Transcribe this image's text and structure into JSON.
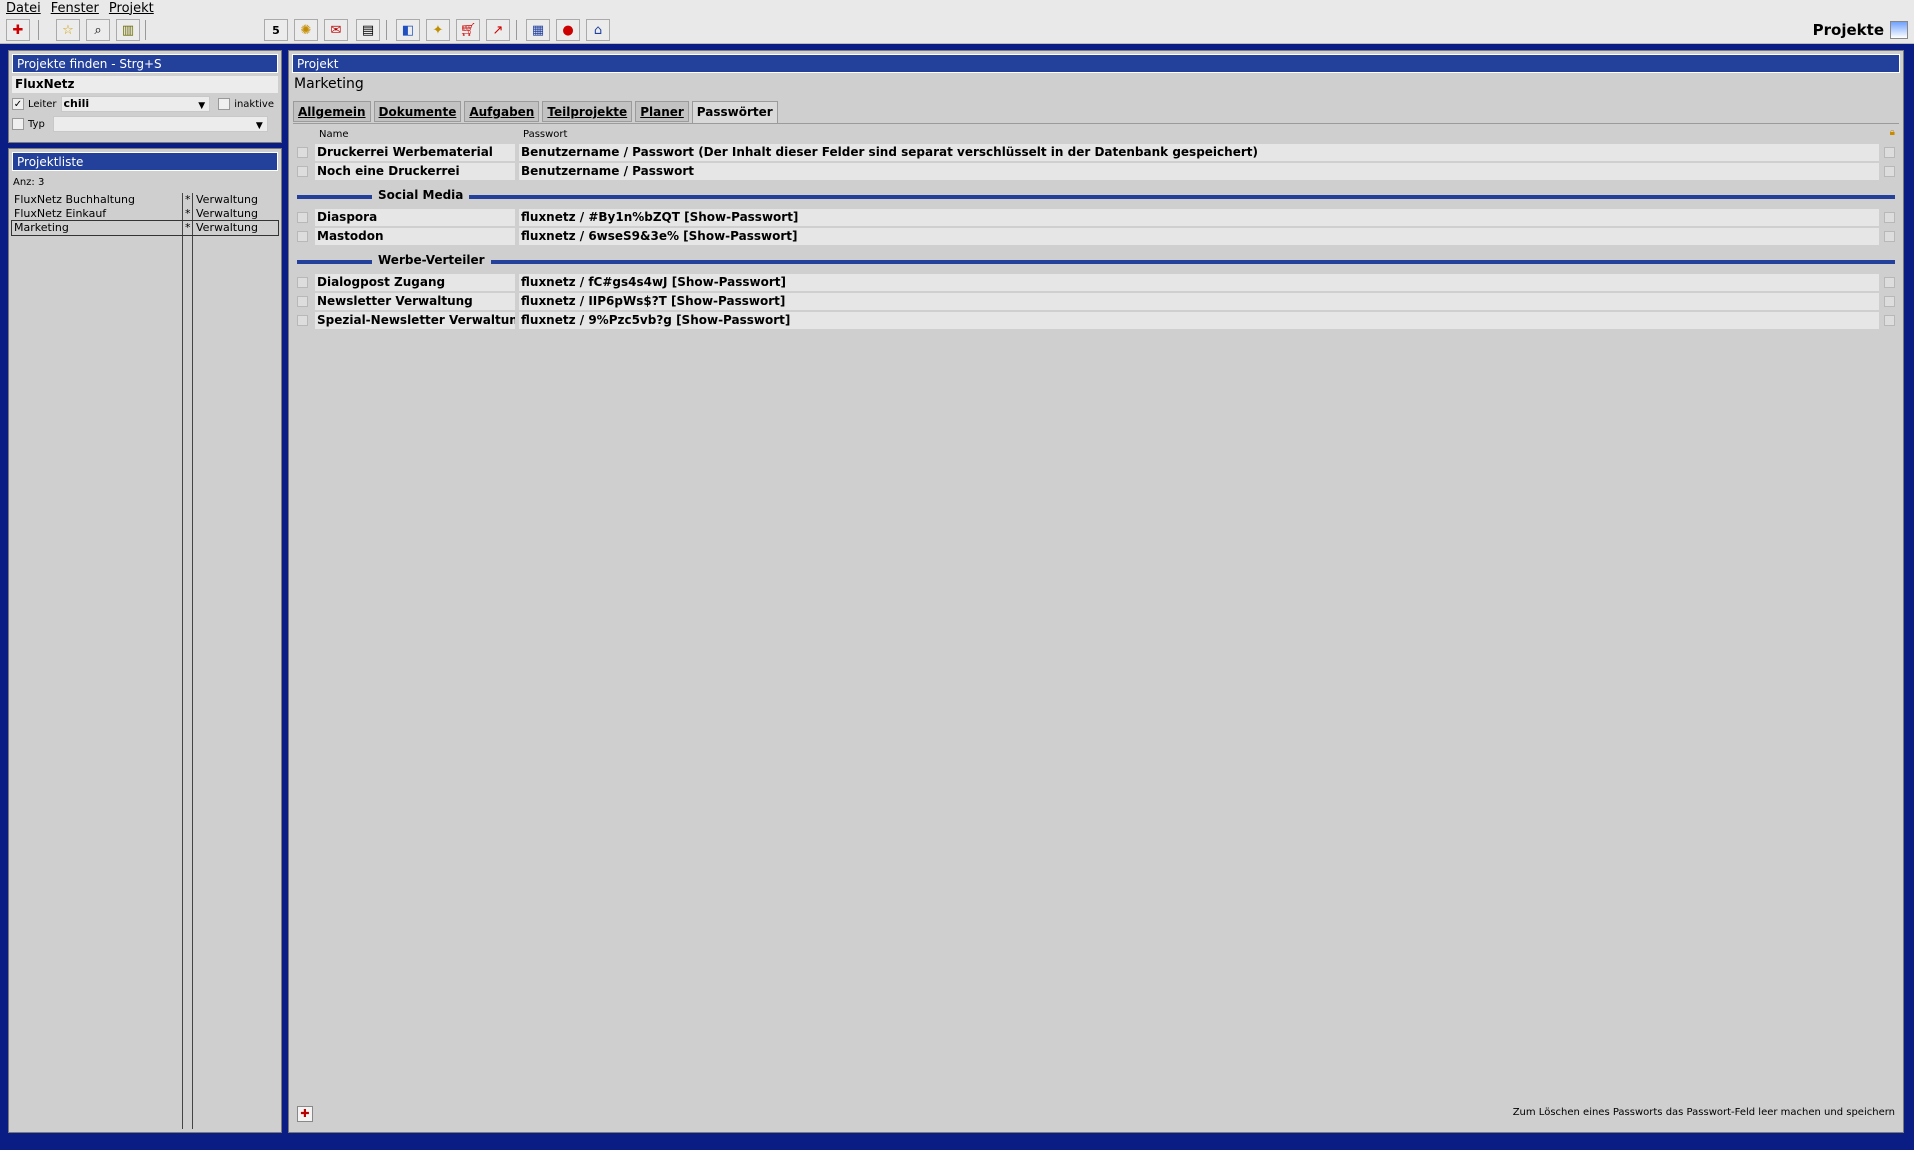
{
  "menu": [
    "Datei",
    "Fenster",
    "Projekt"
  ],
  "app_title": "Projekte",
  "toolbar_icons": [
    "new-project-icon",
    "favorites-icon",
    "search-icon",
    "columns-icon",
    "calendar-icon",
    "compass-icon",
    "mail-icon",
    "cabinet-icon",
    "window-icon",
    "wand-icon",
    "cart-icon",
    "chart-icon",
    "book-icon",
    "chat-icon",
    "home-icon"
  ],
  "search": {
    "header": "Projekte finden - Strg+S",
    "value": "FluxNetz",
    "leiter_label": "Leiter",
    "leiter_checked": "✓",
    "leiter_value": "chili",
    "inaktive_label": "inaktive",
    "typ_label": "Typ",
    "typ_value": ""
  },
  "projektliste": {
    "header": "Projektliste",
    "count": "Anz: 3",
    "rows": [
      {
        "name": "FluxNetz Buchhaltung",
        "flag": "*",
        "type": "Verwaltung"
      },
      {
        "name": "FluxNetz Einkauf",
        "flag": "*",
        "type": "Verwaltung"
      },
      {
        "name": "Marketing",
        "flag": "*",
        "type": "Verwaltung"
      }
    ]
  },
  "main": {
    "header": "Projekt",
    "project_name": "Marketing",
    "tabs": [
      "Allgemein",
      "Dokumente",
      "Aufgaben",
      "Teilprojekte",
      "Planer",
      "Passwörter"
    ],
    "active_tab": "Passwörter",
    "col_name": "Name",
    "col_passwort": "Passwort",
    "ungrouped": [
      {
        "name": "Druckerrei Werbematerial",
        "pass": "Benutzername / Passwort (Der Inhalt dieser Felder sind separat verschlüsselt in der Datenbank gespeichert)"
      },
      {
        "name": "Noch eine Druckerrei",
        "pass": "Benutzername / Passwort"
      }
    ],
    "groups": [
      {
        "title": "Social Media",
        "rows": [
          {
            "name": "Diaspora",
            "pass": "fluxnetz / #By1n%bZQT [Show-Passwort]"
          },
          {
            "name": "Mastodon",
            "pass": "fluxnetz / 6wseS9&3e% [Show-Passwort]"
          }
        ]
      },
      {
        "title": "Werbe-Verteiler",
        "rows": [
          {
            "name": "Dialogpost Zugang",
            "pass": "fluxnetz / fC#gs4s4wJ [Show-Passwort]"
          },
          {
            "name": "Newsletter Verwaltung",
            "pass": "fluxnetz / IIP6pWs$?T [Show-Passwort]"
          },
          {
            "name": "Spezial-Newsletter Verwaltung",
            "pass": "fluxnetz / 9%Pzc5vb?g [Show-Passwort]"
          }
        ]
      }
    ],
    "footer_hint": "Zum Löschen eines Passworts das Passwort-Feld leer machen und speichern"
  }
}
